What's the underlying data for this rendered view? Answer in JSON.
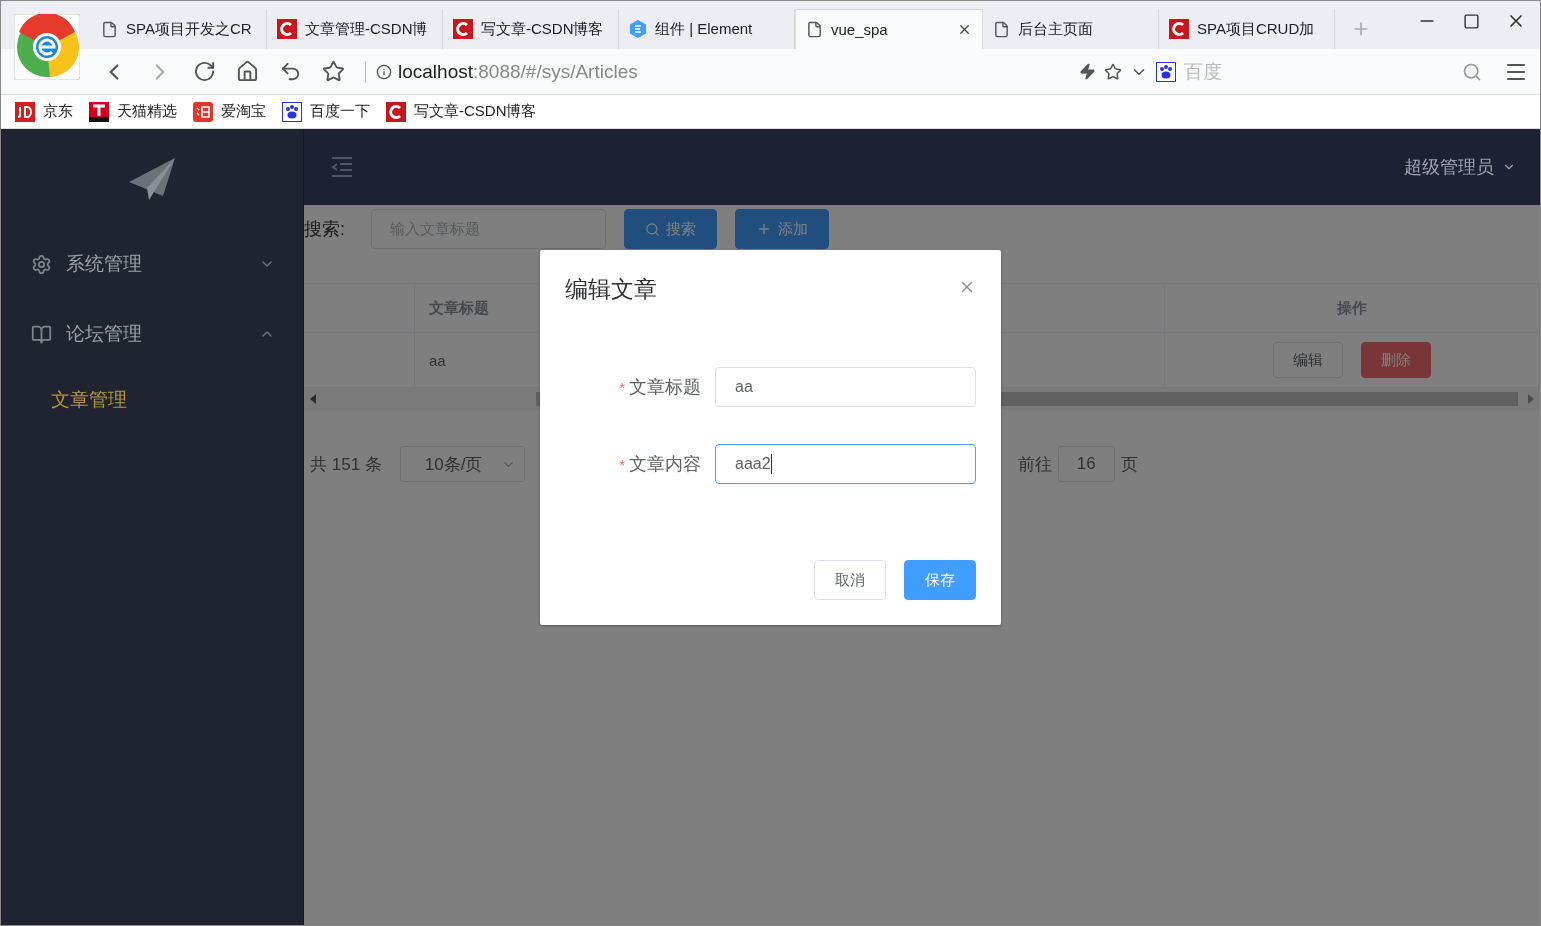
{
  "browser": {
    "tabs": [
      {
        "title": "SPA项目开发之CR",
        "kind": "page",
        "selected": false
      },
      {
        "title": "文章管理-CSDN博",
        "kind": "csdn",
        "selected": false
      },
      {
        "title": "写文章-CSDN博客",
        "kind": "csdn",
        "selected": false
      },
      {
        "title": "组件 | Element",
        "kind": "element",
        "selected": false
      },
      {
        "title": "vue_spa",
        "kind": "page",
        "selected": true
      },
      {
        "title": "后台主页面",
        "kind": "page",
        "selected": false
      },
      {
        "title": "SPA项目CRUD加",
        "kind": "csdn",
        "selected": false
      }
    ],
    "url_host": "localhost",
    "url_path": ":8088/#/sys/Articles",
    "search_placeholder": "百度",
    "bookmarks": [
      {
        "label": "京东",
        "kind": "jd"
      },
      {
        "label": "天猫精选",
        "kind": "tmall"
      },
      {
        "label": "爱淘宝",
        "kind": "taobao"
      },
      {
        "label": "百度一下",
        "kind": "baidu"
      },
      {
        "label": "写文章-CSDN博客",
        "kind": "csdn"
      }
    ]
  },
  "sidebar": {
    "menus": [
      {
        "label": "系统管理",
        "kind": "gear",
        "expanded": false
      },
      {
        "label": "论坛管理",
        "kind": "book",
        "expanded": true,
        "children": [
          {
            "label": "文章管理",
            "selected": true
          }
        ]
      }
    ]
  },
  "header": {
    "user": "超级管理员"
  },
  "toolbar": {
    "search_label": "搜索:",
    "search_placeholder": "输入文章标题",
    "buttons": [
      {
        "label": "搜索",
        "kind": "search"
      },
      {
        "label": "添加",
        "kind": "plus"
      }
    ]
  },
  "table": {
    "headers": [
      "文章标题",
      "操作"
    ],
    "rows": [
      {
        "title": "aa",
        "actions": [
          {
            "label": "编辑",
            "kind": "default"
          },
          {
            "label": "删除",
            "kind": "danger"
          }
        ]
      }
    ]
  },
  "pagination": {
    "total": "共 151 条",
    "page_size": "10条/页",
    "goto_label": "前往",
    "page": "16",
    "page_suffix": "页"
  },
  "dialog": {
    "title": "编辑文章",
    "fields": [
      {
        "label": "文章标题",
        "value": "aa",
        "required_mark": "*",
        "focused": false
      },
      {
        "label": "文章内容",
        "value": "aaa2",
        "required_mark": "*",
        "focused": true
      }
    ],
    "buttons": [
      {
        "label": "取消",
        "kind": "default"
      },
      {
        "label": "保存",
        "kind": "primary"
      }
    ]
  }
}
